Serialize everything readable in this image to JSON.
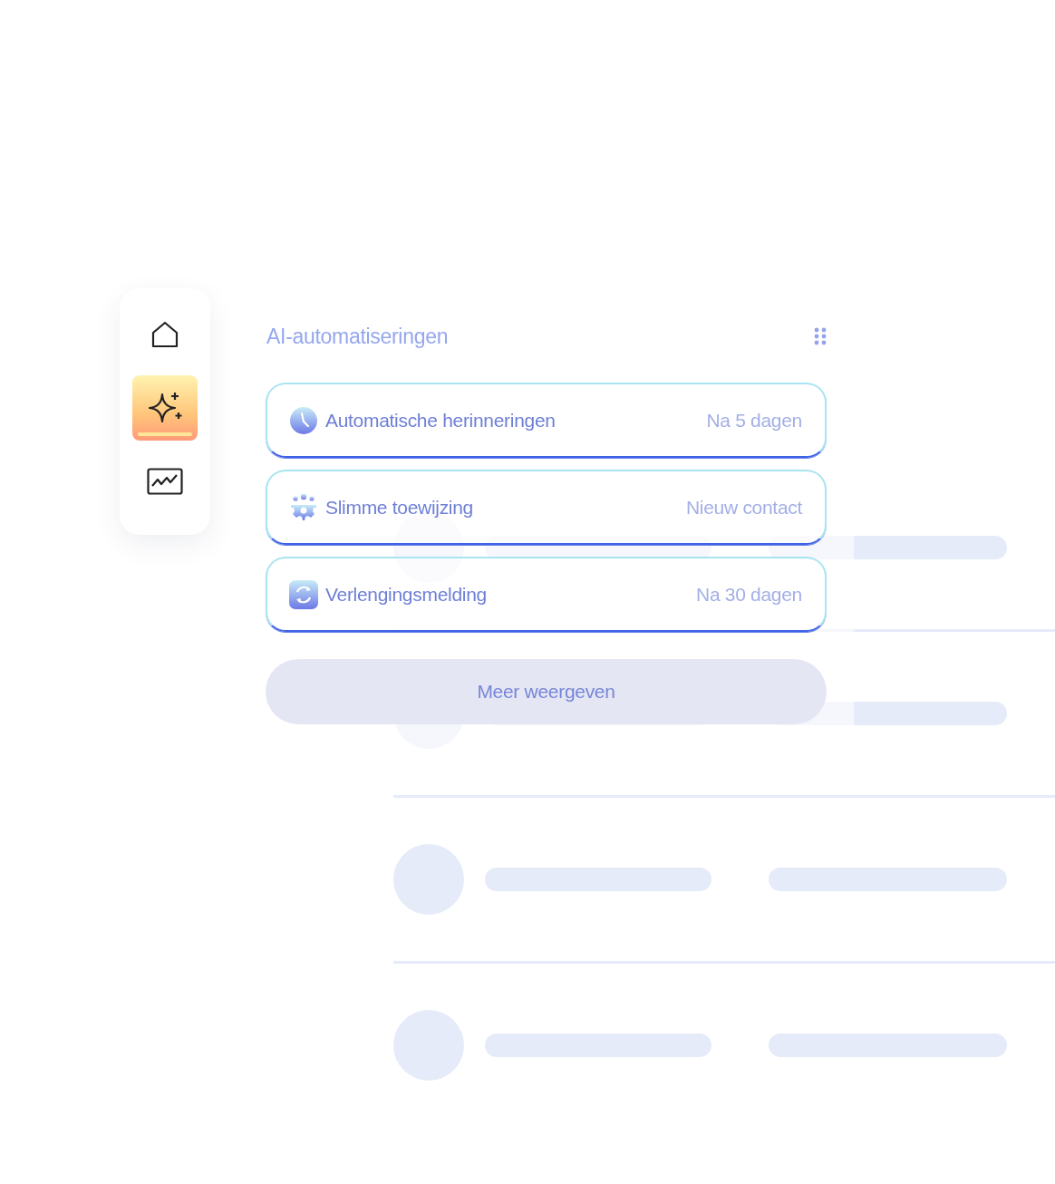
{
  "sidebar": {
    "items": [
      {
        "selected": false
      },
      {
        "selected": true
      },
      {
        "selected": false
      }
    ]
  },
  "table": {
    "rows": [
      {
        "kind": "placeholder"
      },
      {
        "kind": "placeholder"
      },
      {
        "kind": "placeholder"
      },
      {
        "kind": "placeholder"
      }
    ]
  },
  "panel": {
    "title": "AI-automatiseringen",
    "items": [
      {
        "kind": "clock",
        "label": "Automatische herinneringen",
        "value": "Na 5 dagen"
      },
      {
        "kind": "team",
        "label": "Slimme toewijzing",
        "value": "Nieuw contact"
      },
      {
        "kind": "renew",
        "label": "Verlengingsmelding",
        "value": "Na 30 dagen"
      }
    ],
    "button": "Meer weergeven"
  }
}
